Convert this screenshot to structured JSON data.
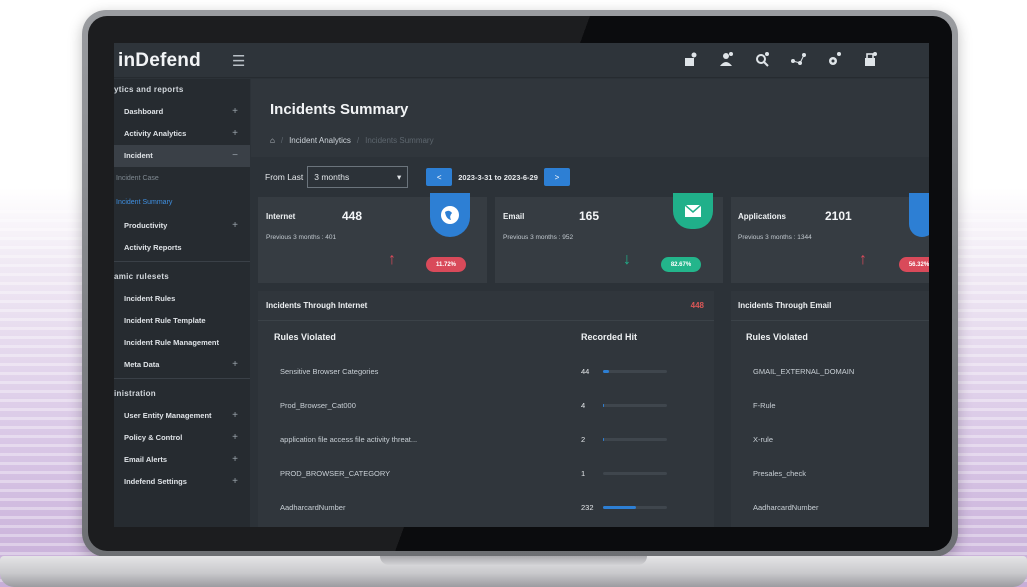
{
  "app": {
    "brand": "inDefend",
    "menu_icon": "hamburger-icon",
    "top_icons": [
      "user-add-icon",
      "user-settings-icon",
      "search-user-icon",
      "share-icon",
      "key-icon",
      "lock-icon"
    ]
  },
  "sidebar": {
    "sections": [
      {
        "label": "ytics and reports"
      },
      {
        "label": "amic rulesets"
      },
      {
        "label": "inistration"
      }
    ],
    "items_analytics": [
      {
        "label": "Dashboard",
        "expander": "+"
      },
      {
        "label": "Activity Analytics",
        "expander": "+"
      },
      {
        "label": "Incident",
        "expander": "−"
      }
    ],
    "incident_sub": [
      "Incident Case",
      "Incident Summary"
    ],
    "items_analytics2": [
      {
        "label": "Productivity",
        "expander": "+"
      },
      {
        "label": "Activity Reports",
        "expander": ""
      }
    ],
    "items_rulesets": [
      {
        "label": "Incident Rules",
        "expander": ""
      },
      {
        "label": "Incident Rule Template",
        "expander": ""
      },
      {
        "label": "Incident Rule Management",
        "expander": ""
      },
      {
        "label": "Meta Data",
        "expander": "+"
      }
    ],
    "items_admin": [
      {
        "label": "User Entity Management",
        "expander": "+"
      },
      {
        "label": "Policy & Control",
        "expander": "+"
      },
      {
        "label": "Email Alerts",
        "expander": "+"
      },
      {
        "label": "Indefend Settings",
        "expander": "+"
      }
    ]
  },
  "header": {
    "title": "Incidents Summary",
    "breadcrumb_home_icon": "home-icon",
    "breadcrumb": [
      "Incident Analytics",
      "Incidents Summary"
    ]
  },
  "filter": {
    "label": "From Last",
    "selected": "3 months",
    "date_range": "2023-3-31 to 2023-6-29",
    "prev_label": "<",
    "next_label": ">"
  },
  "cards": [
    {
      "title": "Internet",
      "value": "448",
      "previous": "Previous 3 months : 401",
      "change": "11.72%",
      "trend": "up",
      "icon": "globe-icon",
      "color": "#2d7fd4",
      "badge_color": "#d94a5a"
    },
    {
      "title": "Email",
      "value": "165",
      "previous": "Previous 3 months : 952",
      "change": "82.67%",
      "trend": "down",
      "icon": "envelope-icon",
      "color": "#20b08a",
      "badge_color": "#23b58b"
    },
    {
      "title": "Applications",
      "value": "2101",
      "previous": "Previous 3 months : 1344",
      "change": "56.32%",
      "trend": "up",
      "icon": "apps-icon",
      "color": "#2d7fd4",
      "badge_color": "#d94a5a"
    }
  ],
  "internet_panel": {
    "title": "Incidents Through Internet",
    "count": "448",
    "columns": [
      "Rules Violated",
      "Recorded Hit"
    ],
    "rows": [
      {
        "rule": "Sensitive Browser Categories",
        "hits": "44",
        "share": 0.1
      },
      {
        "rule": "Prod_Browser_Cat000",
        "hits": "4",
        "share": 0.01
      },
      {
        "rule": "application file access file activity threat...",
        "hits": "2",
        "share": 0.005
      },
      {
        "rule": "PROD_BROWSER_CATEGORY",
        "hits": "1",
        "share": 0.002
      },
      {
        "rule": "AadharcardNumber",
        "hits": "232",
        "share": 0.52
      }
    ]
  },
  "email_panel": {
    "title": "Incidents Through Email",
    "columns": [
      "Rules Violated"
    ],
    "rows": [
      "GMAIL_EXTERNAL_DOMAIN",
      "F-Rule",
      "X-rule",
      "Presales_check",
      "AadharcardNumber"
    ]
  },
  "colors": {
    "accent": "#2d7fd4",
    "danger": "#d94a5a",
    "success": "#20b08a",
    "surface": "#2c3238",
    "sidebar": "#262b30"
  }
}
